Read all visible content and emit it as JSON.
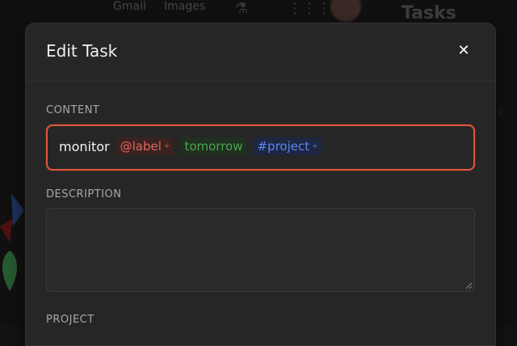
{
  "background": {
    "topbar": {
      "gmail": "Gmail",
      "images": "Images",
      "labs_icon": "flask-icon",
      "apps_icon": "apps-grid-icon"
    },
    "tasks_title": "Tasks"
  },
  "modal": {
    "title": "Edit Task",
    "close_icon": "close-icon",
    "content_label": "CONTENT",
    "content": {
      "text": "monitor",
      "tokens": [
        {
          "text": "@label",
          "kind": "label",
          "color": "#e0665a"
        },
        {
          "text": "tomorrow",
          "kind": "date",
          "color": "#4fa34f"
        },
        {
          "text": "#project",
          "kind": "project",
          "color": "#5d86f0"
        }
      ],
      "plus": "+"
    },
    "description_label": "DESCRIPTION",
    "description_value": "",
    "project_label": "PROJECT"
  },
  "colors": {
    "accent_border": "#e0563c",
    "modal_bg": "#262626"
  }
}
